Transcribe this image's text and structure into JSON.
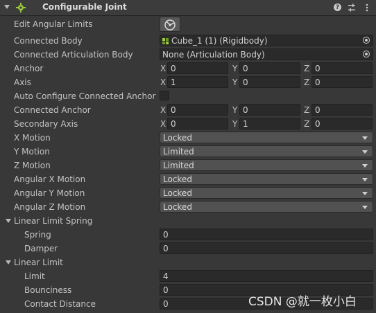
{
  "component": {
    "title": "Configurable Joint",
    "icons": [
      "help-icon",
      "preset-icon",
      "menu-icon"
    ]
  },
  "edit_angular_limits": {
    "label": "Edit Angular Limits"
  },
  "connected_body": {
    "label": "Connected Body",
    "value": "Cube_1 (1) (Rigidbody)"
  },
  "connected_articulation_body": {
    "label": "Connected Articulation Body",
    "value": "None (Articulation Body)"
  },
  "anchor": {
    "label": "Anchor",
    "x": "0",
    "y": "0",
    "z": "0"
  },
  "axis": {
    "label": "Axis",
    "x": "1",
    "y": "0",
    "z": "0"
  },
  "auto_configure": {
    "label": "Auto Configure Connected Anchor",
    "checked": false
  },
  "connected_anchor": {
    "label": "Connected Anchor",
    "x": "0",
    "y": "0",
    "z": "0"
  },
  "secondary_axis": {
    "label": "Secondary Axis",
    "x": "0",
    "y": "1",
    "z": "0"
  },
  "axis_labels": {
    "x": "X",
    "y": "Y",
    "z": "Z"
  },
  "motions": [
    {
      "label": "X Motion",
      "value": "Locked"
    },
    {
      "label": "Y Motion",
      "value": "Limited"
    },
    {
      "label": "Z Motion",
      "value": "Limited"
    },
    {
      "label": "Angular X Motion",
      "value": "Locked"
    },
    {
      "label": "Angular Y Motion",
      "value": "Locked"
    },
    {
      "label": "Angular Z Motion",
      "value": "Locked"
    }
  ],
  "linear_limit_spring": {
    "label": "Linear Limit Spring",
    "spring": {
      "label": "Spring",
      "value": "0"
    },
    "damper": {
      "label": "Damper",
      "value": "0"
    }
  },
  "linear_limit": {
    "label": "Linear Limit",
    "limit": {
      "label": "Limit",
      "value": "4"
    },
    "bounciness": {
      "label": "Bounciness",
      "value": "0"
    },
    "contact_distance": {
      "label": "Contact Distance",
      "value": "0"
    }
  },
  "watermark": "CSDN @就一枚小白",
  "colors": {
    "background": "#383838",
    "field": "#2a2a2a",
    "dropdown": "#515151",
    "icon_green": "#9ccc3c"
  }
}
